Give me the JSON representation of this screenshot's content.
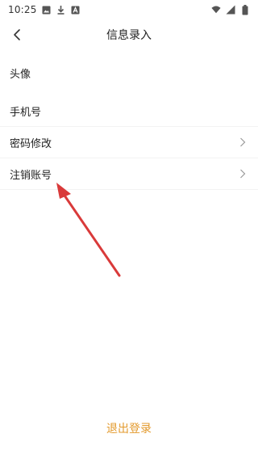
{
  "status_bar": {
    "time": "10:25",
    "icons_left": [
      "image-icon",
      "download-icon",
      "text-icon"
    ],
    "icons_right": [
      "wifi-icon",
      "signal-icon",
      "battery-icon"
    ]
  },
  "header": {
    "title": "信息录入"
  },
  "items": [
    {
      "label": "头像"
    },
    {
      "label": "手机号"
    },
    {
      "label": "密码修改"
    },
    {
      "label": "注销账号"
    }
  ],
  "logout": {
    "label": "退出登录"
  },
  "colors": {
    "accent": "#e39a2d",
    "annotation": "#d93a3a",
    "text": "#222222",
    "chevron": "#9a9a9a"
  }
}
